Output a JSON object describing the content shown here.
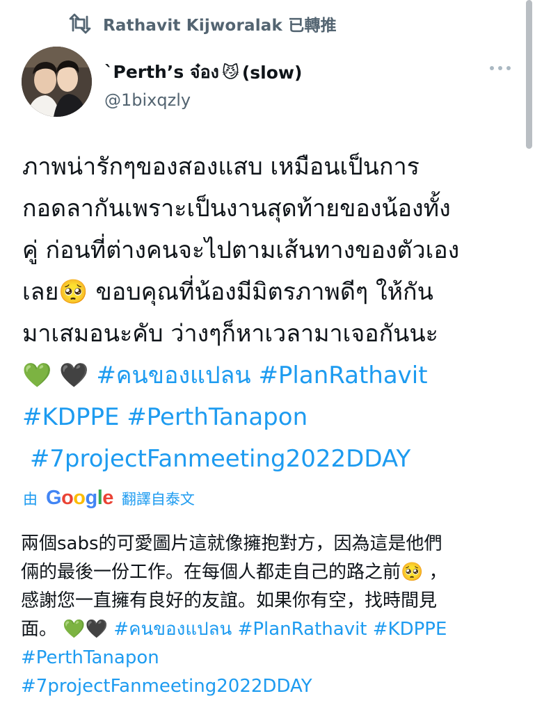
{
  "retweet": {
    "icon": "retweet-icon",
    "text": "Rathavit Kijworalak 已轉推"
  },
  "author": {
    "avatar": "avatar",
    "name_prefix": "`Perth’s จ๋อง",
    "name_emoji": "😼",
    "name_suffix": "(slow)",
    "handle": "@1bixqzly"
  },
  "more_icon": "more-horizontal-icon",
  "tweet": {
    "line1": "ภาพน่ารักๆของสองแสบ เหมือนเป็นการ",
    "line2": "กอดลากันเพราะเป็นงานสุดท้ายของน้องทั้ง",
    "line3": "คู่ ก่อนที่ต่างคนจะไปตามเส้นทางของตัวเอง",
    "line4_a": "เลย",
    "line4_emoji": "🥺",
    "line4_b": " ขอบคุณที่น้องมีมิตรภาพดีๆ ให้กัน",
    "line5": "มาเสมอนะคับ ว่างๆก็หาเวลามาเจอกันนะ",
    "heart_green": "💚",
    "heart_black": "🖤",
    "hashtag1": "#คนของแปลน",
    "hashtag2": "#PlanRathavit",
    "hashtag3": "#KDPPE",
    "hashtag4": "#PerthTanapon",
    "hashtag5": "#7projectFanmeeting2022DDAY"
  },
  "translate": {
    "prefix": "由",
    "logo": "Google",
    "suffix": "翻譯自泰文"
  },
  "translation": {
    "line1": "兩個sabs的可愛圖片這就像擁抱對方，因為這是他們",
    "line2_a": "倆的最後一份工作。在每個人都走自己的路之前",
    "line2_emoji": "🥺",
    "line2_b": " ，",
    "line3": "感謝您一直擁有良好的友誼。如果你有空，找時間見",
    "line4_a": "面。 ",
    "heart_green": "💚",
    "heart_black": "🖤",
    "hashtag1": "#คนของแปลน",
    "hashtag2": "#PlanRathavit",
    "hashtag3": "#KDPPE",
    "hashtag4": "#PerthTanapon",
    "hashtag5": "#7projectFanmeeting2022DDAY"
  },
  "colors": {
    "link": "#1d9bf0",
    "secondary_text": "#536471",
    "primary_text": "#0f1419"
  }
}
